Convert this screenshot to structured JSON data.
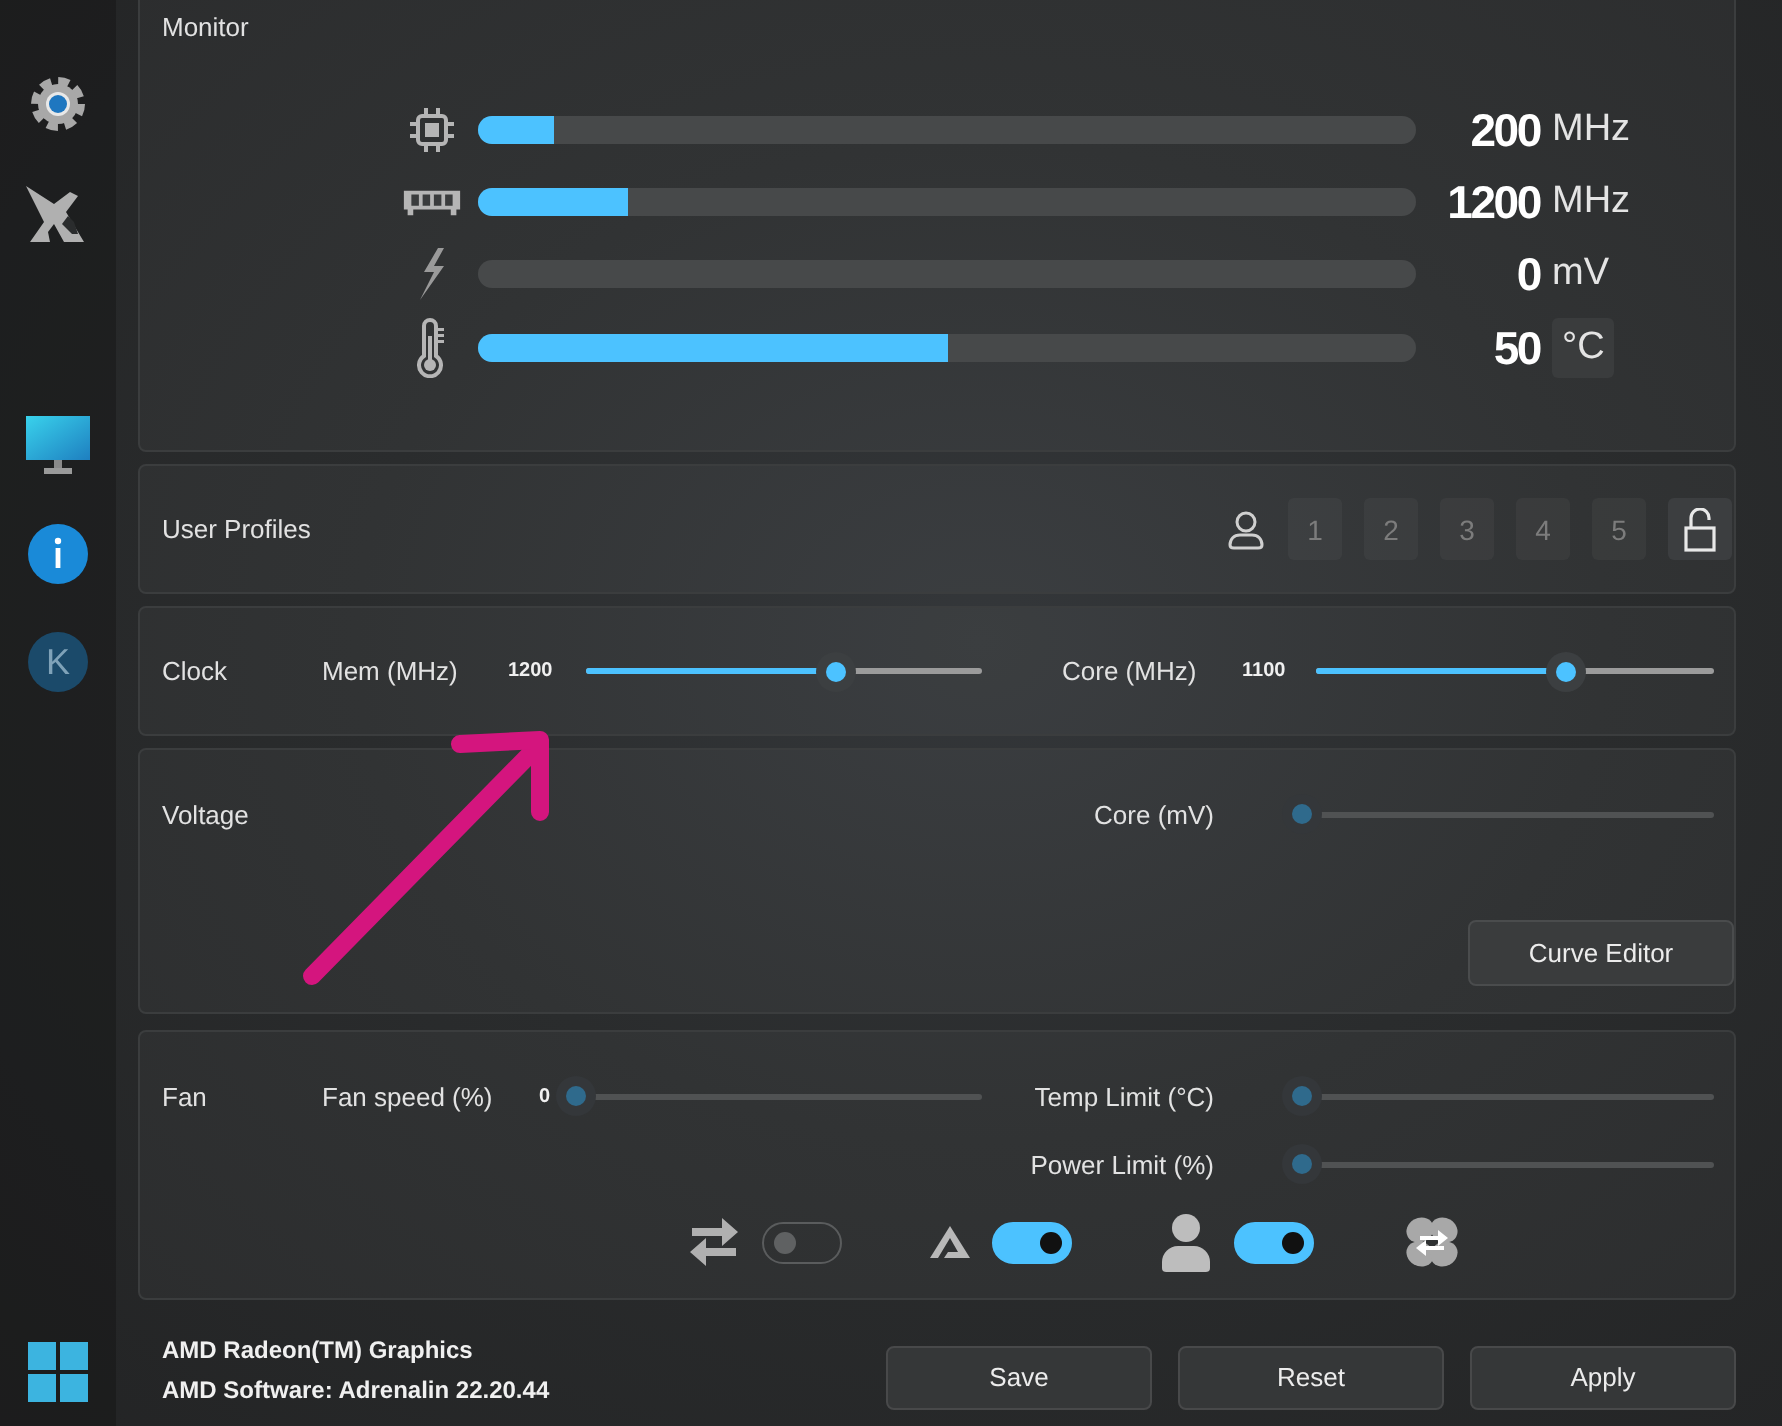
{
  "sidebar": {
    "avatar": "K"
  },
  "monitor": {
    "title": "Monitor",
    "meters": [
      {
        "kind": "chip",
        "value": "200",
        "unit": "MHz",
        "unit_button": false,
        "level": 0.08
      },
      {
        "kind": "memory",
        "value": "1200",
        "unit": "MHz",
        "unit_button": false,
        "level": 0.16
      },
      {
        "kind": "bolt",
        "value": "0",
        "unit": "mV",
        "unit_button": false,
        "level": 0
      },
      {
        "kind": "thermometer",
        "value": "50",
        "unit": "°C",
        "unit_button": true,
        "level": 0.5
      }
    ]
  },
  "profiles": {
    "title": "User Profiles",
    "slots": [
      {
        "label": "1",
        "selected": false
      },
      {
        "label": "2",
        "selected": false
      },
      {
        "label": "3",
        "selected": false
      },
      {
        "label": "4",
        "selected": false
      },
      {
        "label": "5",
        "selected": false
      }
    ],
    "locked": false
  },
  "clock": {
    "title": "Clock",
    "sliders": [
      {
        "label": "Mem (MHz)",
        "value": "1200",
        "level": 0.63,
        "disabled": false
      },
      {
        "label": "Core (MHz)",
        "value": "1100",
        "level": 0.63,
        "disabled": false
      }
    ]
  },
  "voltage": {
    "title": "Voltage",
    "sliders": [
      {
        "label": "Core (mV)",
        "level": 0,
        "disabled": true
      }
    ],
    "button": "Curve Editor"
  },
  "fan": {
    "title": "Fan",
    "sliders": [
      {
        "label": "Fan speed (%)",
        "value": "0",
        "level": 0,
        "disabled": true
      },
      {
        "label": "Temp Limit (°C)",
        "level": 0,
        "disabled": true
      },
      {
        "label": "Power Limit (%)",
        "level": 0,
        "disabled": true
      }
    ],
    "toggles": [
      {
        "kind": "sync",
        "on": false
      },
      {
        "kind": "auto",
        "on": true
      },
      {
        "kind": "user",
        "on": true
      }
    ]
  },
  "footer": {
    "lines": [
      "AMD Radeon(TM) Graphics",
      "AMD Software: Adrenalin 22.20.44"
    ],
    "buttons": [
      "Save",
      "Reset",
      "Apply"
    ]
  }
}
